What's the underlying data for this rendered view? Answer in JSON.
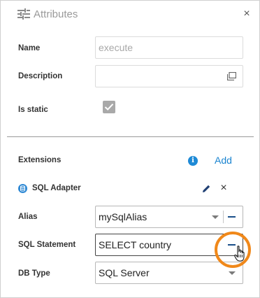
{
  "header": {
    "title": "Attributes",
    "close_label": "×"
  },
  "fields": {
    "name_label": "Name",
    "name_value": "execute",
    "description_label": "Description",
    "description_value": "",
    "is_static_label": "Is static",
    "is_static_checked": true
  },
  "extensions": {
    "label": "Extensions",
    "info_glyph": "i",
    "add_label": "Add",
    "item": {
      "name": "SQL Adapter",
      "remove_label": "×",
      "alias_label": "Alias",
      "alias_value": "mySqlAlias",
      "sql_label": "SQL Statement",
      "sql_value": "SELECT country",
      "db_type_label": "DB Type",
      "db_type_value": "SQL Server"
    }
  },
  "colors": {
    "accent": "#1a84d0",
    "highlight_ring": "#f0881a",
    "info_icon": "#1e8ad6"
  },
  "icons": [
    "tune-icon",
    "close-icon",
    "expand-icon",
    "checkbox-checked-icon",
    "info-icon",
    "database-icon",
    "edit-pencil-icon",
    "dropdown-caret-icon",
    "remove-minus-icon",
    "hand-cursor-icon"
  ]
}
